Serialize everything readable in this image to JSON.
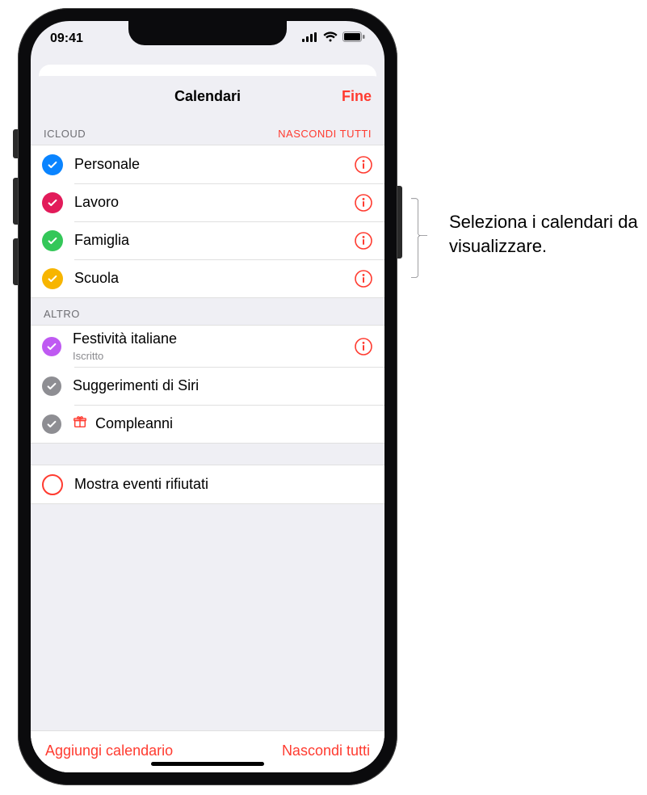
{
  "statusbar": {
    "time": "09:41"
  },
  "sheet": {
    "title": "Calendari",
    "done": "Fine"
  },
  "sections": {
    "icloud": {
      "header": "ICLOUD",
      "hide_all": "NASCONDI TUTTI",
      "items": [
        {
          "label": "Personale",
          "color": "#0a84ff"
        },
        {
          "label": "Lavoro",
          "color": "#e21b5a"
        },
        {
          "label": "Famiglia",
          "color": "#34c759"
        },
        {
          "label": "Scuola",
          "color": "#f7b500"
        }
      ]
    },
    "other": {
      "header": "ALTRO",
      "items": [
        {
          "label": "Festività italiane",
          "sub": "Iscritto",
          "color": "#bf5af2",
          "info": true
        },
        {
          "label": "Suggerimenti di Siri",
          "color": "#8e8e93",
          "info": false
        },
        {
          "label": "Compleanni",
          "color": "#8e8e93",
          "info": false,
          "gift": true
        }
      ]
    },
    "declined": {
      "label": "Mostra eventi rifiutati"
    }
  },
  "footer": {
    "add": "Aggiungi calendario",
    "hide_all": "Nascondi tutti"
  },
  "annotation": {
    "text": "Seleziona i calendari da visualizzare."
  }
}
